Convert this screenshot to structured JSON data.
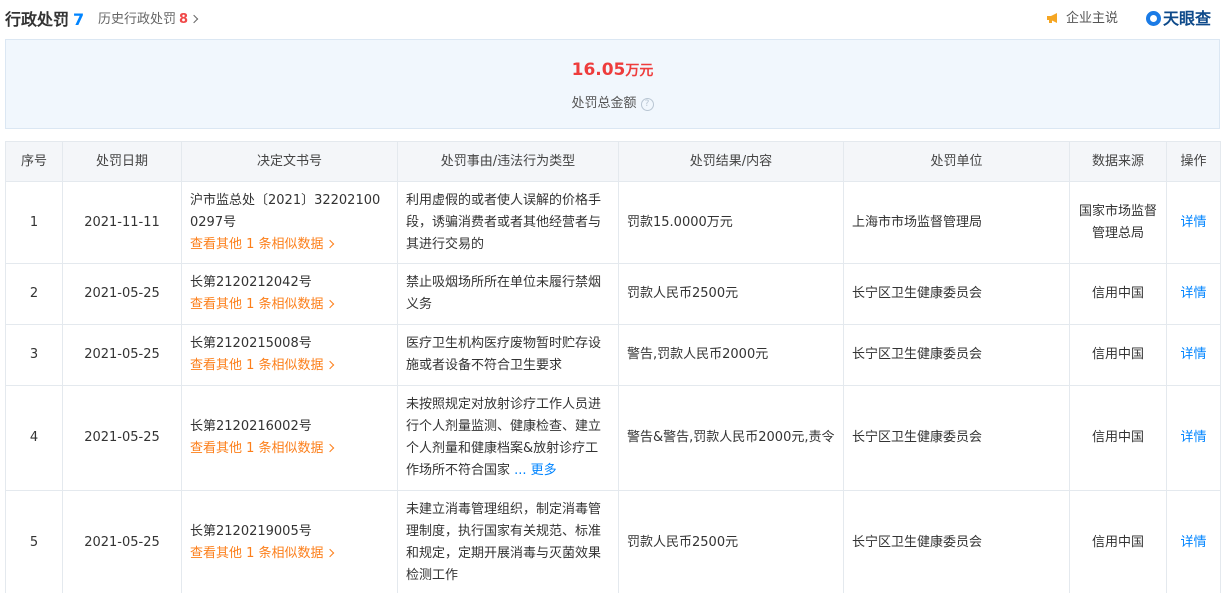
{
  "header": {
    "title": "行政处罚",
    "count": "7",
    "history_label": "历史行政处罚",
    "history_count": "8",
    "claim_label": "企业主说",
    "logo_text": "天眼查"
  },
  "summary": {
    "amount": "16.05",
    "unit": "万元",
    "label": "处罚总金额",
    "help": "?"
  },
  "table": {
    "columns": [
      "序号",
      "处罚日期",
      "决定文书号",
      "处罚事由/违法行为类型",
      "处罚结果/内容",
      "处罚单位",
      "数据来源",
      "操作"
    ],
    "rows": [
      {
        "no": "1",
        "date": "2021-11-11",
        "doc": "沪市监总处〔2021〕32202100 0297号",
        "similar": "查看其他 1 条相似数据",
        "reason": "利用虚假的或者使人误解的价格手段，诱骗消费者或者其他经营者与其进行交易的",
        "result": "罚款15.0000万元",
        "unit": "上海市市场监督管理局",
        "source": "国家市场监督管理总局",
        "action": "详情"
      },
      {
        "no": "2",
        "date": "2021-05-25",
        "doc": "长第2120212042号",
        "similar": "查看其他 1 条相似数据",
        "reason": "禁止吸烟场所所在单位未履行禁烟义务",
        "result": "罚款人民币2500元",
        "unit": "长宁区卫生健康委员会",
        "source": "信用中国",
        "action": "详情"
      },
      {
        "no": "3",
        "date": "2021-05-25",
        "doc": "长第2120215008号",
        "similar": "查看其他 1 条相似数据",
        "reason": "医疗卫生机构医疗废物暂时贮存设施或者设备不符合卫生要求",
        "result": "警告,罚款人民币2000元",
        "unit": "长宁区卫生健康委员会",
        "source": "信用中国",
        "action": "详情"
      },
      {
        "no": "4",
        "date": "2021-05-25",
        "doc": "长第2120216002号",
        "similar": "查看其他 1 条相似数据",
        "reason": "未按照规定对放射诊疗工作人员进行个人剂量监测、健康检查、建立个人剂量和健康档案&放射诊疗工作场所不符合国家",
        "reason_more": "... 更多",
        "result": "警告&警告,罚款人民币2000元,责令",
        "unit": "长宁区卫生健康委员会",
        "source": "信用中国",
        "action": "详情"
      },
      {
        "no": "5",
        "date": "2021-05-25",
        "doc": "长第2120219005号",
        "similar": "查看其他 1 条相似数据",
        "reason": "未建立消毒管理组织，制定消毒管理制度，执行国家有关规范、标准和规定，定期开展消毒与灭菌效果检测工作",
        "result": "罚款人民币2500元",
        "unit": "长宁区卫生健康委员会",
        "source": "信用中国",
        "action": "详情"
      }
    ]
  },
  "colors": {
    "accent": "#0084ff",
    "amount": "#ee3c3c",
    "similar": "#fc7f1b"
  }
}
